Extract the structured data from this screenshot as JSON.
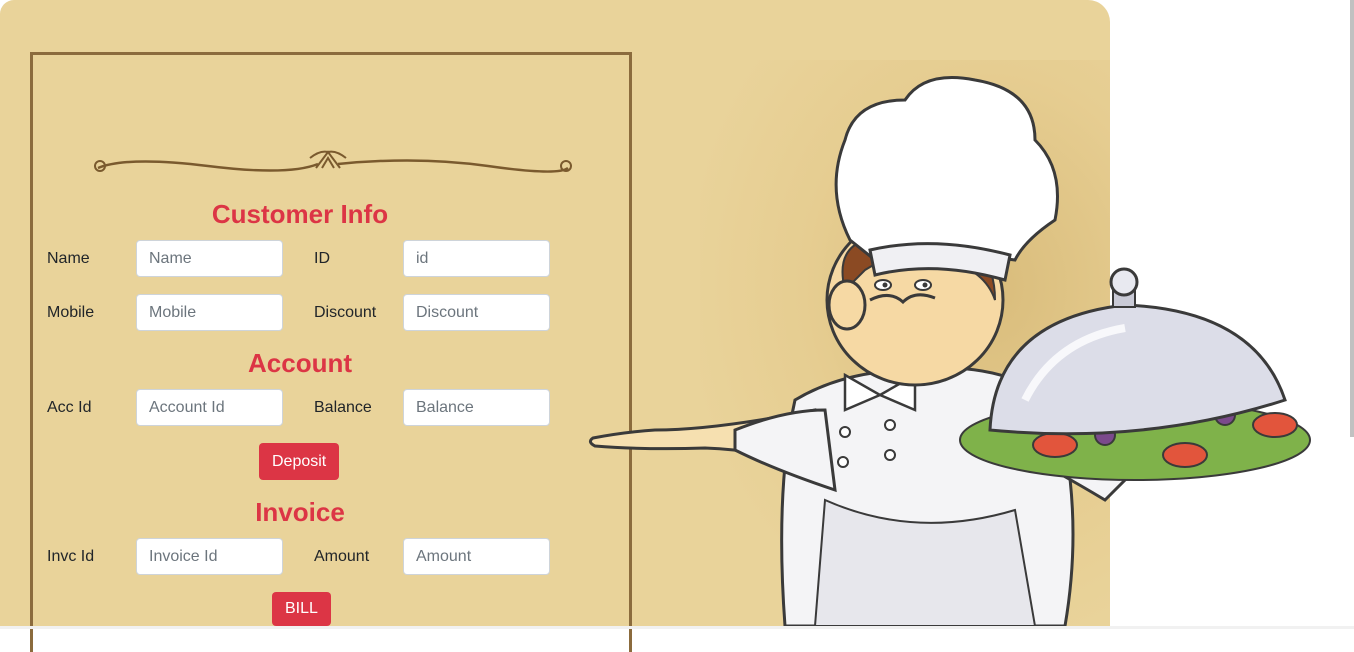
{
  "customer": {
    "title": "Customer Info",
    "name_label": "Name",
    "name_placeholder": "Name",
    "id_label": "ID",
    "id_placeholder": "id",
    "mobile_label": "Mobile",
    "mobile_placeholder": "Mobile",
    "discount_label": "Discount",
    "discount_placeholder": "Discount"
  },
  "account": {
    "title": "Account",
    "acc_id_label": "Acc Id",
    "acc_id_placeholder": "Account Id",
    "balance_label": "Balance",
    "balance_placeholder": "Balance",
    "deposit_button": "Deposit"
  },
  "invoice": {
    "title": "Invoice",
    "invc_id_label": "Invc Id",
    "invc_id_placeholder": "Invoice Id",
    "amount_label": "Amount",
    "amount_placeholder": "Amount",
    "bill_button": "BILL"
  },
  "colors": {
    "accent": "#dc3545",
    "parchment": "#e9d39a",
    "frame": "#8b6b3d"
  },
  "background": {
    "illustration": "chef-holding-cloche-icon"
  }
}
